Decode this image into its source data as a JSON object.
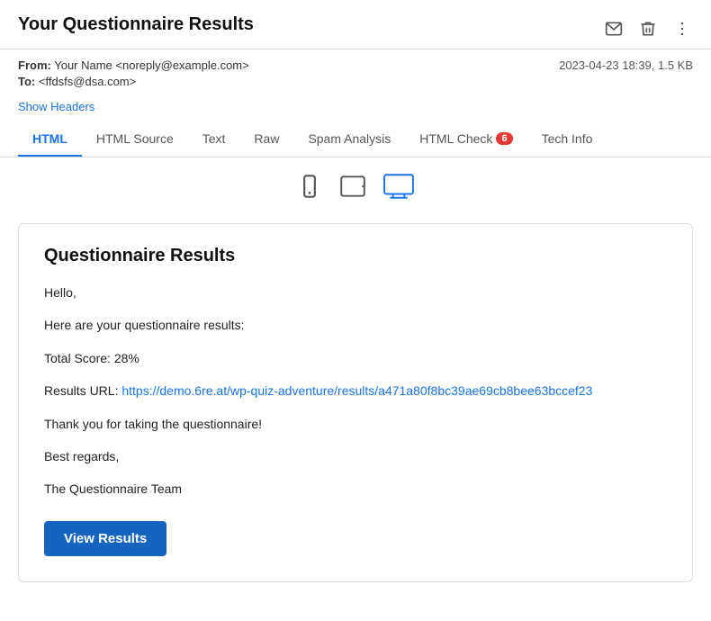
{
  "header": {
    "title": "Your Questionnaire Results",
    "icons": {
      "mail": "✉",
      "trash": "🗑",
      "more": "⋮"
    }
  },
  "meta": {
    "from_label": "From:",
    "from_value": "Your Name <noreply@example.com>",
    "to_label": "To:",
    "to_value": "<ffdsfs@dsa.com>",
    "date": "2023-04-23 18:39, 1.5 KB"
  },
  "show_headers_label": "Show Headers",
  "tabs": [
    {
      "id": "html",
      "label": "HTML",
      "active": true
    },
    {
      "id": "html-source",
      "label": "HTML Source",
      "active": false
    },
    {
      "id": "text",
      "label": "Text",
      "active": false
    },
    {
      "id": "raw",
      "label": "Raw",
      "active": false
    },
    {
      "id": "spam-analysis",
      "label": "Spam Analysis",
      "active": false
    },
    {
      "id": "html-check",
      "label": "HTML Check",
      "badge": "6",
      "active": false
    },
    {
      "id": "tech-info",
      "label": "Tech Info",
      "active": false
    }
  ],
  "view_icons": {
    "mobile": "mobile",
    "tablet": "tablet",
    "desktop": "desktop"
  },
  "body": {
    "title": "Questionnaire Results",
    "greeting": "Hello,",
    "intro": "Here are your questionnaire results:",
    "score_label": "Total Score: 28%",
    "results_url_label": "Results URL:",
    "results_url": "https://demo.6re.at/wp-quiz-adventure/results/a471a80f8bc39ae69cb8bee63bccef23",
    "thank_you": "Thank you for taking the questionnaire!",
    "best_regards": "Best regards,",
    "team_name": "The Questionnaire Team",
    "button_label": "View Results"
  }
}
